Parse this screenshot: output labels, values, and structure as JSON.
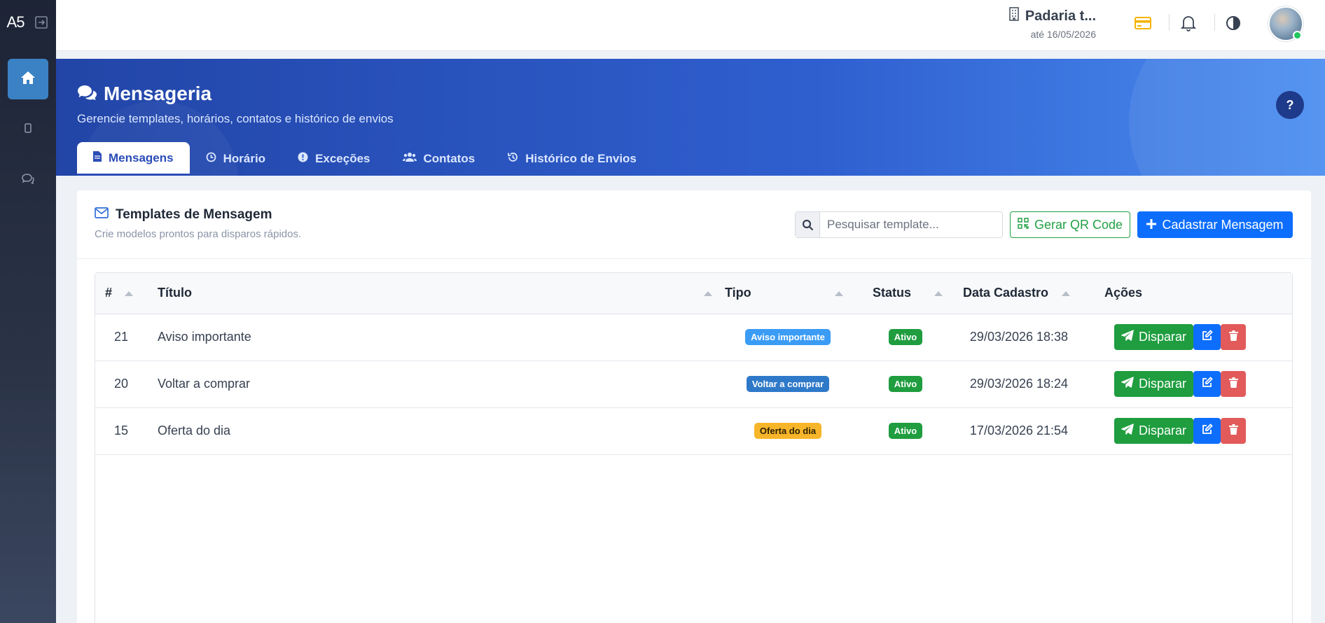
{
  "sidebar": {
    "logo": "A5",
    "items": [
      {
        "icon": "home-icon",
        "active": true
      },
      {
        "icon": "mobile-icon",
        "active": false
      },
      {
        "icon": "chat-icon",
        "active": false
      }
    ]
  },
  "topbar": {
    "company_name": "Padaria t...",
    "company_sub": "até 16/05/2026",
    "icons": [
      "credit-card-icon",
      "bell-icon",
      "contrast-icon"
    ],
    "colors": {
      "card": "#f5b300"
    }
  },
  "hero": {
    "title": "Mensageria",
    "subtitle": "Gerencie templates, horários, contatos e histórico de envios",
    "help": "?",
    "tabs": [
      {
        "label": "Mensagens",
        "active": true
      },
      {
        "label": "Horário",
        "active": false
      },
      {
        "label": "Exceções",
        "active": false
      },
      {
        "label": "Contatos",
        "active": false
      },
      {
        "label": "Histórico de Envios",
        "active": false
      }
    ]
  },
  "card": {
    "title": "Templates de Mensagem",
    "subtitle": "Crie modelos prontos para disparos rápidos.",
    "search_placeholder": "Pesquisar template...",
    "qr_label": "Gerar QR Code",
    "new_label": "Cadastrar Mensagem"
  },
  "table": {
    "columns": [
      "#",
      "Título",
      "Tipo",
      "Status",
      "Data Cadastro",
      "Ações"
    ],
    "rows": [
      {
        "id": "21",
        "title": "Aviso importante",
        "type": "Aviso importante",
        "type_color": "#3b9cf5",
        "type_text": "#ffffff",
        "status": "Ativo",
        "date": "29/03/2026 18:38"
      },
      {
        "id": "20",
        "title": "Voltar a comprar",
        "type": "Voltar a comprar",
        "type_color": "#2f79c9",
        "type_text": "#ffffff",
        "status": "Ativo",
        "date": "29/03/2026 18:24"
      },
      {
        "id": "15",
        "title": "Oferta do dia",
        "type": "Oferta do dia",
        "type_color": "#f7b52a",
        "type_text": "#2d2200",
        "status": "Ativo",
        "date": "17/03/2026 21:54"
      }
    ],
    "send_label": "Disparar",
    "status_color": "#1f9d3f"
  }
}
